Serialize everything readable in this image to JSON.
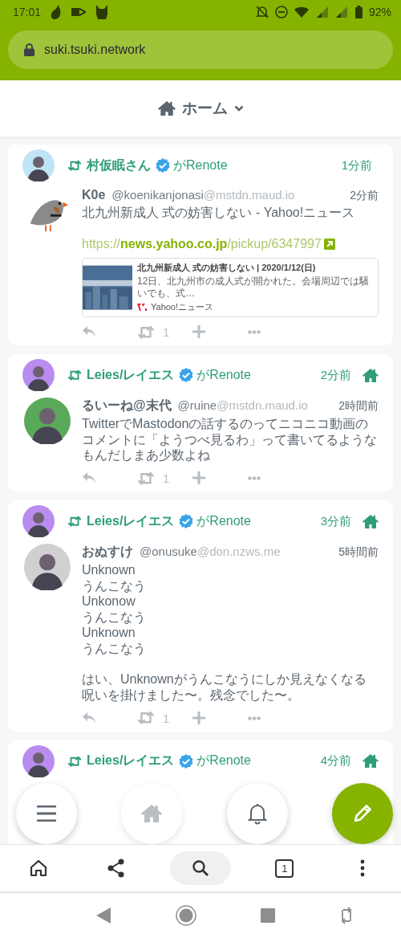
{
  "status_bar": {
    "time": "17:01",
    "battery": "92%"
  },
  "address_bar": {
    "url": "suki.tsuki.network"
  },
  "header": {
    "title": "ホーム"
  },
  "notes": [
    {
      "renoter": {
        "name": "村仮眠さん",
        "verified": true
      },
      "renote_label": "がRenote",
      "time": "1分前",
      "home_only": false,
      "author": {
        "name": "K0e",
        "username": "@koenikanjonasi",
        "host": "@mstdn.maud.io"
      },
      "note_time": "2分前",
      "paragraphs": [
        [
          "北九州新成人 式の妨害しない - Yahoo!ニュース"
        ]
      ],
      "link": {
        "scheme": "https://",
        "host": "news.yahoo.co.jp",
        "path": "/pickup/6347997"
      },
      "preview": {
        "title": "北九州新成人 式の妨害しない | 2020/1/12(日)",
        "description": "12日、北九州市の成人式が開かれた。会場周辺では騒いでも、式…",
        "site": "Yahoo!ニュース"
      },
      "renote_count": "1"
    },
    {
      "renoter": {
        "name": "Leies/レイエス",
        "verified": true
      },
      "renote_label": "がRenote",
      "time": "2分前",
      "home_only": true,
      "author": {
        "name": "るいーね@末代",
        "username": "@ruine",
        "host": "@mstdn.maud.io"
      },
      "note_time": "2時間前",
      "paragraphs": [
        [
          "TwitterでMastodonの話するのってニコニコ動画のコメントに「ようつべ見るわ」って書いてるようなもんだしまあ少数よね"
        ]
      ],
      "renote_count": "1"
    },
    {
      "renoter": {
        "name": "Leies/レイエス",
        "verified": true
      },
      "renote_label": "がRenote",
      "time": "3分前",
      "home_only": true,
      "author": {
        "name": "おぬすけ",
        "username": "@onusuke",
        "host": "@don.nzws.me"
      },
      "note_time": "5時間前",
      "paragraphs": [
        [
          "Unknown",
          "うんこなう",
          "Unkonow",
          "うんこなう",
          "Unknown",
          "うんこなう"
        ],
        [
          "はい、Unknownがうんこなうにしか見えなくなる呪いを掛けました〜。残念でした〜。"
        ]
      ],
      "renote_count": "1"
    },
    {
      "renoter": {
        "name": "Leies/レイエス",
        "verified": true
      },
      "renote_label": "がRenote",
      "time": "4分前",
      "home_only": true
    }
  ],
  "fabs": [
    {
      "kind": "menu",
      "faded": false
    },
    {
      "kind": "home",
      "faded": true
    },
    {
      "kind": "notifications",
      "faded": false
    },
    {
      "kind": "compose",
      "faded": false
    }
  ],
  "browser_toolbar": [
    {
      "kind": "home",
      "selected": false
    },
    {
      "kind": "share",
      "selected": false
    },
    {
      "kind": "search",
      "selected": true
    },
    {
      "kind": "tabs",
      "count": "1",
      "selected": false
    },
    {
      "kind": "more",
      "selected": false
    }
  ]
}
